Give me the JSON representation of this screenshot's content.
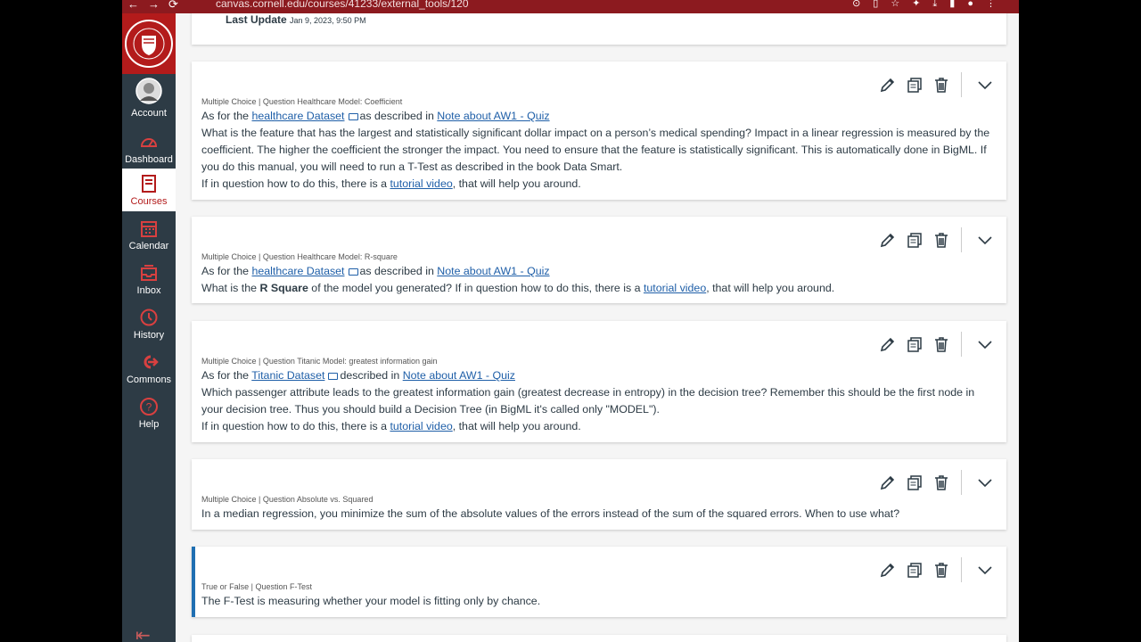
{
  "browser": {
    "url": "canvas.cornell.edu/courses/41233/external_tools/120"
  },
  "sidebar": {
    "items": [
      {
        "label": "Account",
        "icon": "avatar"
      },
      {
        "label": "Dashboard",
        "icon": "dashboard-icon"
      },
      {
        "label": "Courses",
        "icon": "courses-icon"
      },
      {
        "label": "Calendar",
        "icon": "calendar-icon"
      },
      {
        "label": "Inbox",
        "icon": "inbox-icon"
      },
      {
        "label": "History",
        "icon": "history-icon"
      },
      {
        "label": "Commons",
        "icon": "commons-icon"
      },
      {
        "label": "Help",
        "icon": "help-icon"
      }
    ]
  },
  "header": {
    "last_update_label": "Last Update",
    "last_update_time": "Jan 9, 2023, 9:50 PM"
  },
  "questions": [
    {
      "meta": "Multiple Choice | Question Healthcare Model: Coefficient",
      "as_for": "As for the",
      "dataset_link": "healthcare Dataset",
      "as_described": "as described in",
      "note_link": "Note about AW1 - Quiz",
      "text": "What is the feature that has the largest and statistically significant dollar impact on a person’s medical spending? Impact in a linear regression is measured by the coefficient. The higher the coefficient the stronger the impact. You need to ensure that the feature is statistically significant. This is automatically done in BigML. If you do this manual, you will need to run a T-Test as described in the book Data Smart.",
      "help_prefix": "If in question how to do this, there is a",
      "help_link": "tutorial video",
      "help_suffix": ", that will help you around."
    },
    {
      "meta": "Multiple Choice | Question Healthcare Model: R-square",
      "as_for": "As for the",
      "dataset_link": "healthcare Dataset",
      "as_described": "as described in",
      "note_link": "Note about AW1 - Quiz",
      "text_prefix": "What is the",
      "text_bold": "R Square",
      "text_suffix": "of the model you generated? If in question how to do this, there is a",
      "help_link": "tutorial video",
      "help_suffix": ", that will help you around."
    },
    {
      "meta": "Multiple Choice | Question Titanic Model: greatest information gain",
      "as_for": "As for the",
      "dataset_link": "Titanic Dataset",
      "as_described": "described in",
      "note_link": "Note about AW1 - Quiz",
      "text": "Which passenger attribute leads to the greatest information gain (greatest decrease in entropy) in the decision tree? Remember this should be the first node in your decision tree. Thus you should build a Decision Tree (in BigML it's called only \"MODEL\").",
      "help_prefix": "If in question how to do this, there is a",
      "help_link": "tutorial video",
      "help_suffix": ", that will help you around."
    },
    {
      "meta": "Multiple Choice | Question Absolute vs. Squared",
      "text": "In a median regression, you minimize the sum of the absolute values of the errors instead of the sum of the squared errors. When to use what?"
    },
    {
      "meta": "True or False | Question F-Test",
      "text": "The F-Test is measuring whether your model is fitting only by chance."
    }
  ]
}
